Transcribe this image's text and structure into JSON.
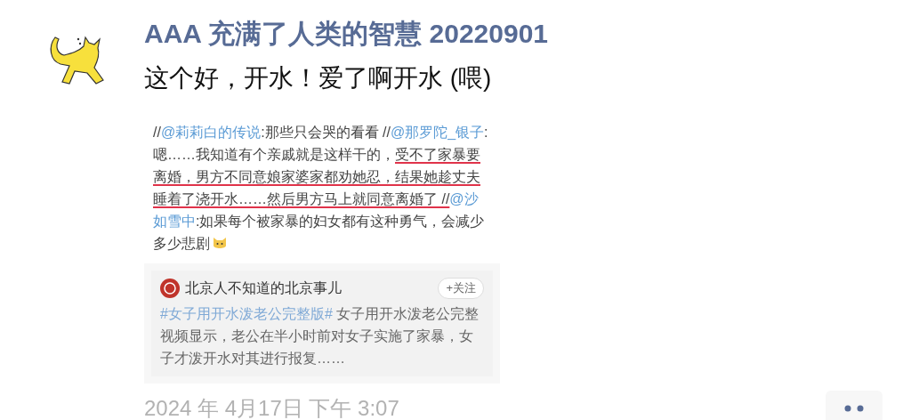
{
  "post": {
    "author": "AAA 充满了人类的智慧 20220901",
    "text": "这个好，开水！爱了啊开水 (喂)"
  },
  "repost": {
    "segments": [
      {
        "kind": "text",
        "text": "//",
        "underlined": false
      },
      {
        "kind": "mention",
        "text": "@莉莉白的传说",
        "underlined": false
      },
      {
        "kind": "text",
        "text": ":那些只会哭的看看 //",
        "underlined": false
      },
      {
        "kind": "mention",
        "text": "@那罗陀_银子",
        "underlined": false
      },
      {
        "kind": "text",
        "text": ":嗯……我知道有个亲戚就是这样干的，",
        "underlined": false
      },
      {
        "kind": "text",
        "text": "受不了家暴要离婚，男方不同意娘家婆家都劝她忍，结果她趁丈夫睡着了浇开水……然后男方马上就同意离婚了 //",
        "underlined": true
      },
      {
        "kind": "mention",
        "text": "@沙如雪中",
        "underlined": false
      },
      {
        "kind": "text",
        "text": ":如果每个被家暴的妇女都有这种勇气，会减少多少悲剧",
        "underlined": false
      }
    ],
    "card": {
      "account": "北京人不知道的北京事儿",
      "follow": "+关注",
      "hashtag": "#女子用开水泼老公完整版#",
      "body": " 女子用开水泼老公完整视频显示，老公在半小时前对女子实施了家暴，女子才泼开水对其进行报复……"
    }
  },
  "timestamp": "2024 年 4月17日 下午 3:07"
}
